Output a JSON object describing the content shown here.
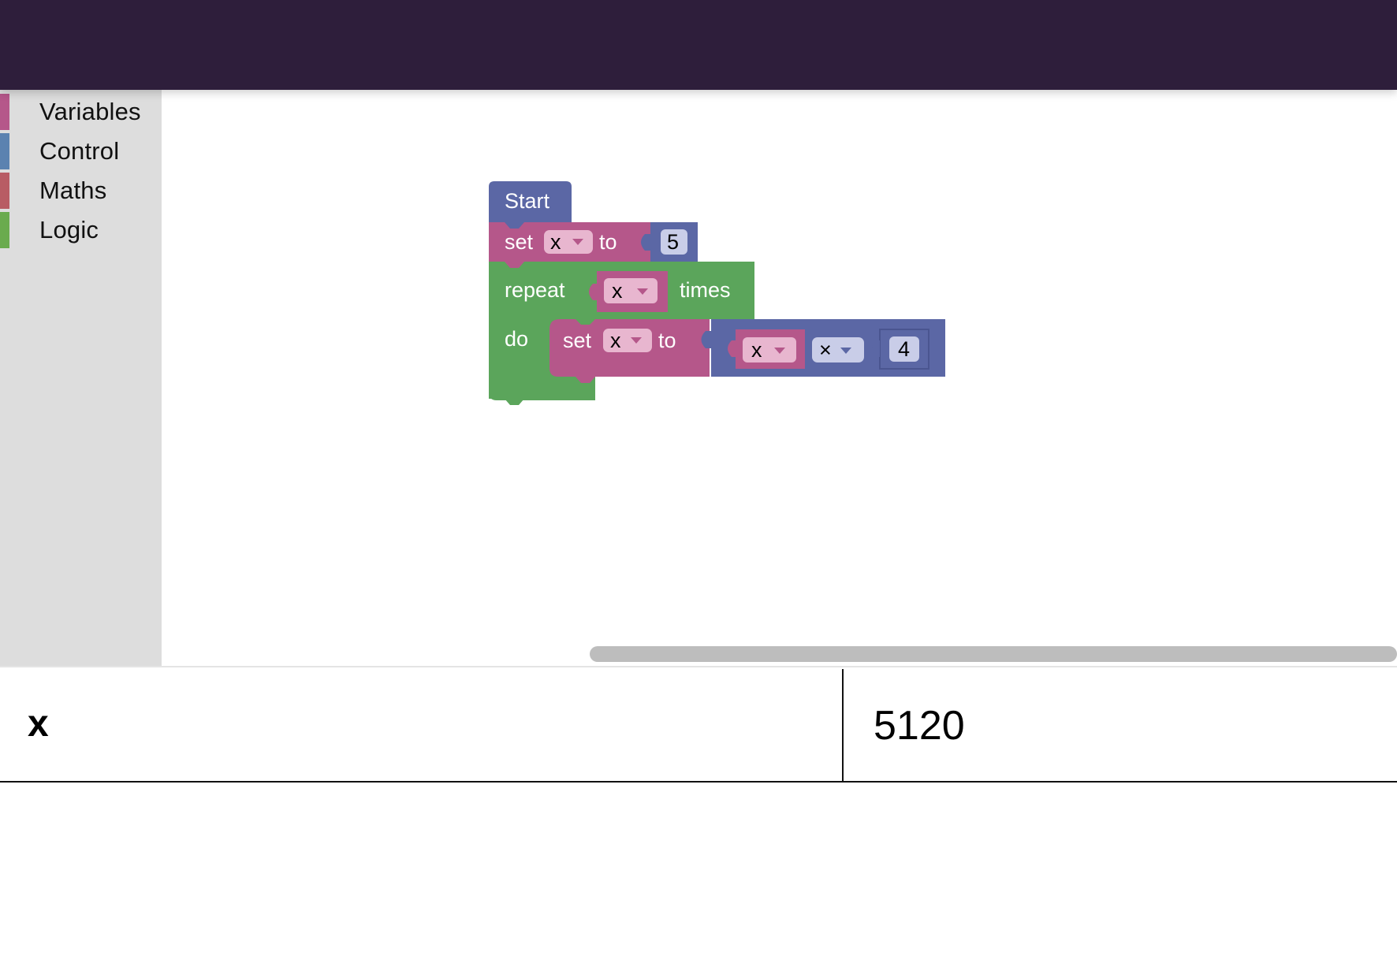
{
  "colors": {
    "topbar": "#2e1e3b",
    "toolbox_bg": "#dddddd",
    "variables": "#a55b80",
    "control": "#5b80a5",
    "maths": "#a5625b",
    "logic": "#5ba55b",
    "start_block": "#5b67a5",
    "math_block": "#5b67a5"
  },
  "toolbox": {
    "categories": [
      {
        "label": "Variables",
        "color": "#b5578a"
      },
      {
        "label": "Control",
        "color": "#5b82b0"
      },
      {
        "label": "Maths",
        "color": "#b85c64"
      },
      {
        "label": "Logic",
        "color": "#6aab4e"
      }
    ]
  },
  "program": {
    "start": {
      "label": "Start"
    },
    "set1": {
      "set": "set",
      "var": "x",
      "to": "to",
      "value": "5"
    },
    "repeat": {
      "repeat": "repeat",
      "var": "x",
      "times": "times",
      "do": "do"
    },
    "set2": {
      "set": "set",
      "var": "x",
      "to": "to"
    },
    "arith": {
      "left": "x",
      "op": "×",
      "right": "4"
    }
  },
  "variables_table": {
    "rows": [
      {
        "name": "x",
        "value": "5120"
      }
    ]
  }
}
